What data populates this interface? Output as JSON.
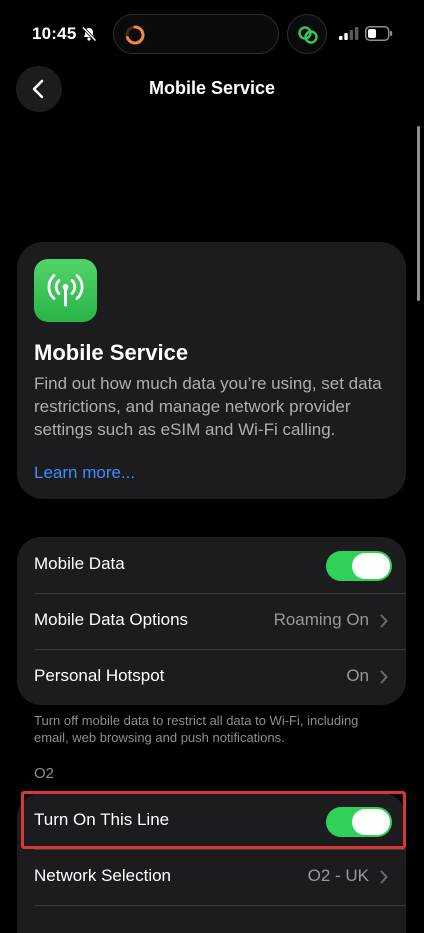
{
  "status_bar": {
    "time": "10:45",
    "icons": [
      "bell-slash-icon",
      "activity-ring-icon",
      "link-icon",
      "signal-icon",
      "battery-icon"
    ]
  },
  "nav": {
    "title": "Mobile Service",
    "back_icon": "chevron-left-icon"
  },
  "info_card": {
    "icon": "antenna-icon",
    "title": "Mobile Service",
    "description": "Find out how much data you’re using, set data restrictions, and manage network provider settings such as eSIM and Wi-Fi calling.",
    "link": "Learn more..."
  },
  "data_group": {
    "rows": [
      {
        "label": "Mobile Data",
        "toggle_on": true
      },
      {
        "label": "Mobile Data Options",
        "value": "Roaming On"
      },
      {
        "label": "Personal Hotspot",
        "value": "On"
      }
    ],
    "footer": "Turn off mobile data to restrict all data to Wi-Fi, including email, web browsing and push notifications."
  },
  "carrier_section": {
    "header": "O2",
    "rows": [
      {
        "label": "Turn On This Line",
        "toggle_on": true
      },
      {
        "label": "Network Selection",
        "value": "O2 - UK"
      }
    ]
  },
  "colors": {
    "background": "#000000",
    "cell": "#1c1c1e",
    "toggle_on": "#30d158",
    "link": "#3d8bff",
    "highlight": "#d63838"
  }
}
